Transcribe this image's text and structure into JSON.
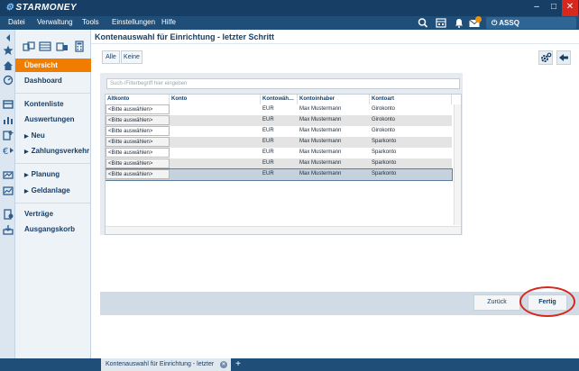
{
  "app": {
    "logo": "STARMONEY"
  },
  "menu": {
    "items": [
      "Datei",
      "Verwaltung",
      "Tools",
      "Einstellungen",
      "Hilfe"
    ]
  },
  "toolbar": {
    "user_label": "ASSQ",
    "icons": [
      "search-icon",
      "calendar-icon",
      "bell-icon",
      "mail-icon",
      "power-icon"
    ]
  },
  "nav": {
    "items": [
      {
        "label": "Übersicht",
        "active": true
      },
      {
        "label": "Dashboard"
      },
      {
        "label": "Kontenliste"
      },
      {
        "label": "Auswertungen"
      },
      {
        "label": "Neu",
        "expandable": true
      },
      {
        "label": "Zahlungsverkehr",
        "expandable": true
      },
      {
        "label": "Planung",
        "expandable": true
      },
      {
        "label": "Geldanlage",
        "expandable": true
      },
      {
        "label": "Verträge"
      },
      {
        "label": "Ausgangskorb"
      }
    ]
  },
  "main": {
    "title": "Kontenauswahl für Einrichtung - letzter Schritt",
    "filter_buttons": {
      "all": "Alle",
      "none": "Keine"
    },
    "search_placeholder": "Such-/Filterbegriff hier eingeben",
    "columns": [
      "Altkonto",
      "Konto",
      "Kontowäh…",
      "Kontoinhaber",
      "Kontoart"
    ],
    "rows": [
      {
        "altkonto": "<Bitte auswählen>",
        "konto": "",
        "waehrung": "EUR",
        "inhaber": "Max Mustermann",
        "art": "Girokonto"
      },
      {
        "altkonto": "<Bitte auswählen>",
        "konto": "",
        "waehrung": "EUR",
        "inhaber": "Max Mustermann",
        "art": "Girokonto"
      },
      {
        "altkonto": "<Bitte auswählen>",
        "konto": "",
        "waehrung": "EUR",
        "inhaber": "Max Mustermann",
        "art": "Girokonto"
      },
      {
        "altkonto": "<Bitte auswählen>",
        "konto": "",
        "waehrung": "EUR",
        "inhaber": "Max Mustermann",
        "art": "Sparkonto"
      },
      {
        "altkonto": "<Bitte auswählen>",
        "konto": "",
        "waehrung": "EUR",
        "inhaber": "Max Mustermann",
        "art": "Sparkonto"
      },
      {
        "altkonto": "<Bitte auswählen>",
        "konto": "",
        "waehrung": "EUR",
        "inhaber": "Max Mustermann",
        "art": "Sparkonto"
      },
      {
        "altkonto": "<Bitte auswählen>",
        "konto": "",
        "waehrung": "EUR",
        "inhaber": "Max Mustermann",
        "art": "Sparkonto"
      }
    ],
    "back_label": "Zurück",
    "finish_label": "Fertig"
  },
  "tabs": {
    "document_tab": "Kontenauswahl für Einrichtung - letzter Schritt"
  },
  "colors": {
    "accent": "#f07d00",
    "titlebar": "#173f66",
    "highlight_ring": "#d8281d"
  }
}
